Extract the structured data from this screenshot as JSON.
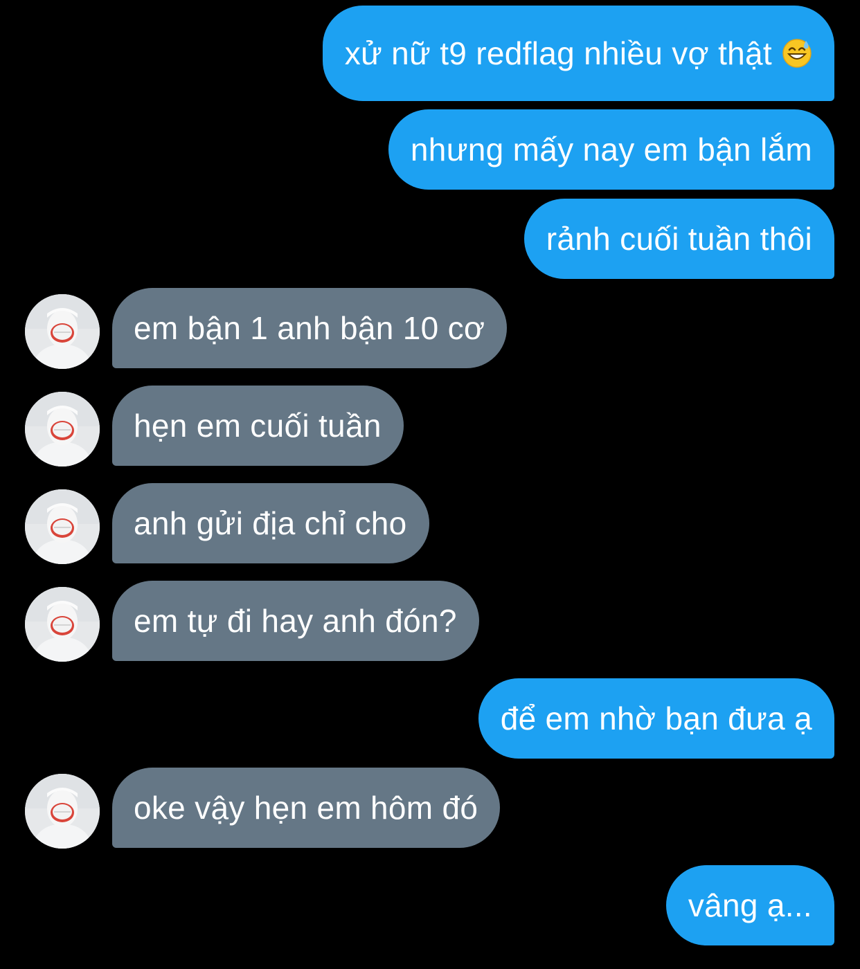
{
  "conversation": {
    "messages": [
      {
        "id": "m1",
        "sender": "me",
        "text": "xử nữ t9 redflag nhiều vợ thật",
        "emoji": "grinning-sweat-emoji"
      },
      {
        "id": "m2",
        "sender": "me",
        "text": "nhưng mấy nay em bận lắm"
      },
      {
        "id": "m3",
        "sender": "me",
        "text": "rảnh cuối tuần thôi"
      },
      {
        "id": "m4",
        "sender": "them",
        "text": "em bận 1 anh bận 10 cơ"
      },
      {
        "id": "m5",
        "sender": "them",
        "text": "hẹn em cuối tuần"
      },
      {
        "id": "m6",
        "sender": "them",
        "text": "anh gửi địa chỉ cho"
      },
      {
        "id": "m7",
        "sender": "them",
        "text": "em tự đi hay anh đón?"
      },
      {
        "id": "m8",
        "sender": "me",
        "text": "để em nhờ bạn đưa ạ"
      },
      {
        "id": "m9",
        "sender": "them",
        "text": "oke vậy hẹn em hôm đó"
      },
      {
        "id": "m10",
        "sender": "me",
        "text": "vâng ạ..."
      }
    ]
  },
  "colors": {
    "background": "#000000",
    "outgoing_bubble": "#1da1f2",
    "incoming_bubble": "#657786",
    "text": "#ffffff"
  }
}
